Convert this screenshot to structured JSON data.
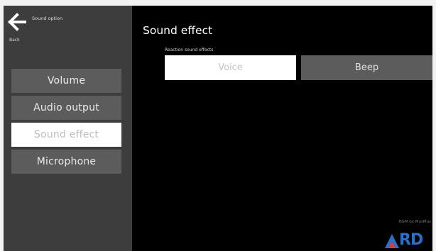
{
  "window": {
    "title": "Sound option"
  },
  "nav": {
    "back_label": "Back",
    "back_icon": "arrow-left-icon"
  },
  "sidebar": {
    "items": [
      {
        "label": "Volume",
        "active": false
      },
      {
        "label": "Audio output",
        "active": false
      },
      {
        "label": "Sound effect",
        "active": true
      },
      {
        "label": "Microphone",
        "active": false
      }
    ]
  },
  "main": {
    "title": "Sound effect",
    "section_label": "Reaction sound effects",
    "options": [
      {
        "label": "Voice",
        "selected": true
      },
      {
        "label": "Beep",
        "selected": false
      }
    ]
  },
  "footer": {
    "bgm_credit": "BGM by MusMus",
    "logo_text": "RD"
  },
  "colors": {
    "sidebar_bg": "#3d3d3d",
    "menu_item_bg": "#5c5c5c",
    "active_item_bg": "#ffffff",
    "main_bg": "#000000",
    "logo_accent": "#2a6fc9"
  }
}
